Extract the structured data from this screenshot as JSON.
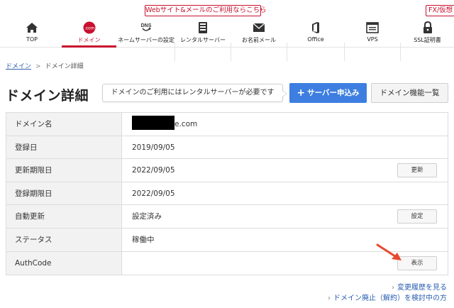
{
  "promo": {
    "label": "Webサイト&メールのご利用ならこちら",
    "right_label": "FX/仮想"
  },
  "nav": {
    "items": [
      {
        "label": "TOP",
        "icon": "home-icon"
      },
      {
        "label": "ドメイン",
        "icon": "dotcom-icon"
      },
      {
        "label": "ネームサーバーの設定",
        "icon": "dns-icon"
      },
      {
        "label": "レンタルサーバー",
        "icon": "server-icon"
      },
      {
        "label": "お名前メール",
        "icon": "mail-icon"
      },
      {
        "label": "Office",
        "icon": "office-icon"
      },
      {
        "label": "VPS",
        "icon": "vps-icon"
      },
      {
        "label": "SSL証明書",
        "icon": "lock-icon"
      }
    ],
    "active_index": 1,
    "dotcom_text": ".com",
    "dns_text": "DNS"
  },
  "breadcrumb": {
    "parent": "ドメイン",
    "current": "ドメイン詳細"
  },
  "page": {
    "title": "ドメイン詳細",
    "notice": "ドメインのご利用にはレンタルサーバーが必要です",
    "primary_button": "サーバー申込み",
    "primary_button_icon": "+",
    "secondary_button": "ドメイン機能一覧"
  },
  "details": {
    "rows": [
      {
        "key": "ドメイン名",
        "value": "e.com",
        "redacted": true
      },
      {
        "key": "登録日",
        "value": "2019/09/05"
      },
      {
        "key": "更新期限日",
        "value": "2022/09/05",
        "button": "更新"
      },
      {
        "key": "登録期限日",
        "value": "2022/09/05"
      },
      {
        "key": "自動更新",
        "value": "設定済み",
        "button": "設定"
      },
      {
        "key": "ステータス",
        "value": "稼働中"
      },
      {
        "key": "AuthCode",
        "value": "",
        "button": "表示"
      }
    ]
  },
  "footer_links": {
    "history": "変更履歴を見る",
    "cancel": "ドメイン廃止（解約）を検討中の方"
  },
  "colors": {
    "brand_red": "#c8102e",
    "primary_blue": "#3d7ee0",
    "arrow": "#e8482f"
  }
}
